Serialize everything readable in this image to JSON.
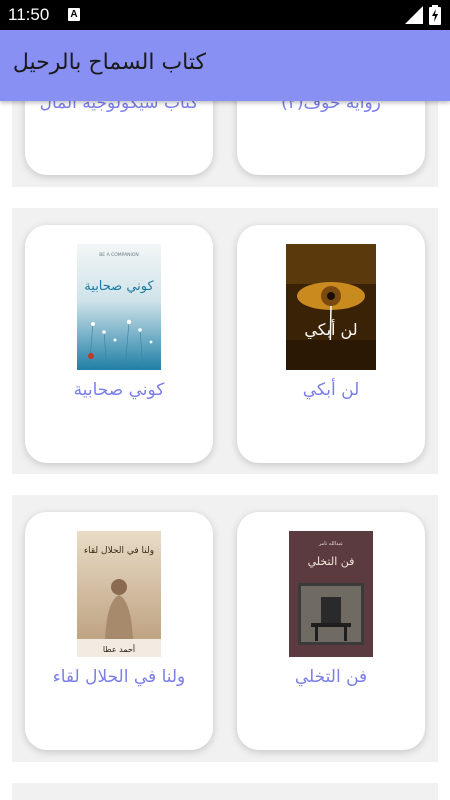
{
  "status_bar": {
    "time": "11:50",
    "notification_badge": "A"
  },
  "app_bar": {
    "title": "كتاب السماح بالرحيل"
  },
  "books": [
    {
      "title": "رواية حوف(٢)"
    },
    {
      "title": "كتاب سيكولوجية المال"
    },
    {
      "title": "لن أبكي",
      "cover_text": "لن أبكي"
    },
    {
      "title": "كوني صحابية",
      "cover_text": "كوني صحابية",
      "cover_subtitle": "BE A COMPANION"
    },
    {
      "title": "فن التخلي",
      "cover_text": "فن التخلي",
      "cover_author": "عبدالله تامر"
    },
    {
      "title": "ولنا في الحلال لقاء",
      "cover_text": "ولنا في الحلال لقاء",
      "cover_author": "أحمد عطا"
    }
  ],
  "colors": {
    "app_bar": "#8891f3",
    "title_text": "#7b7fe8",
    "row_background": "#f1f1f1"
  }
}
